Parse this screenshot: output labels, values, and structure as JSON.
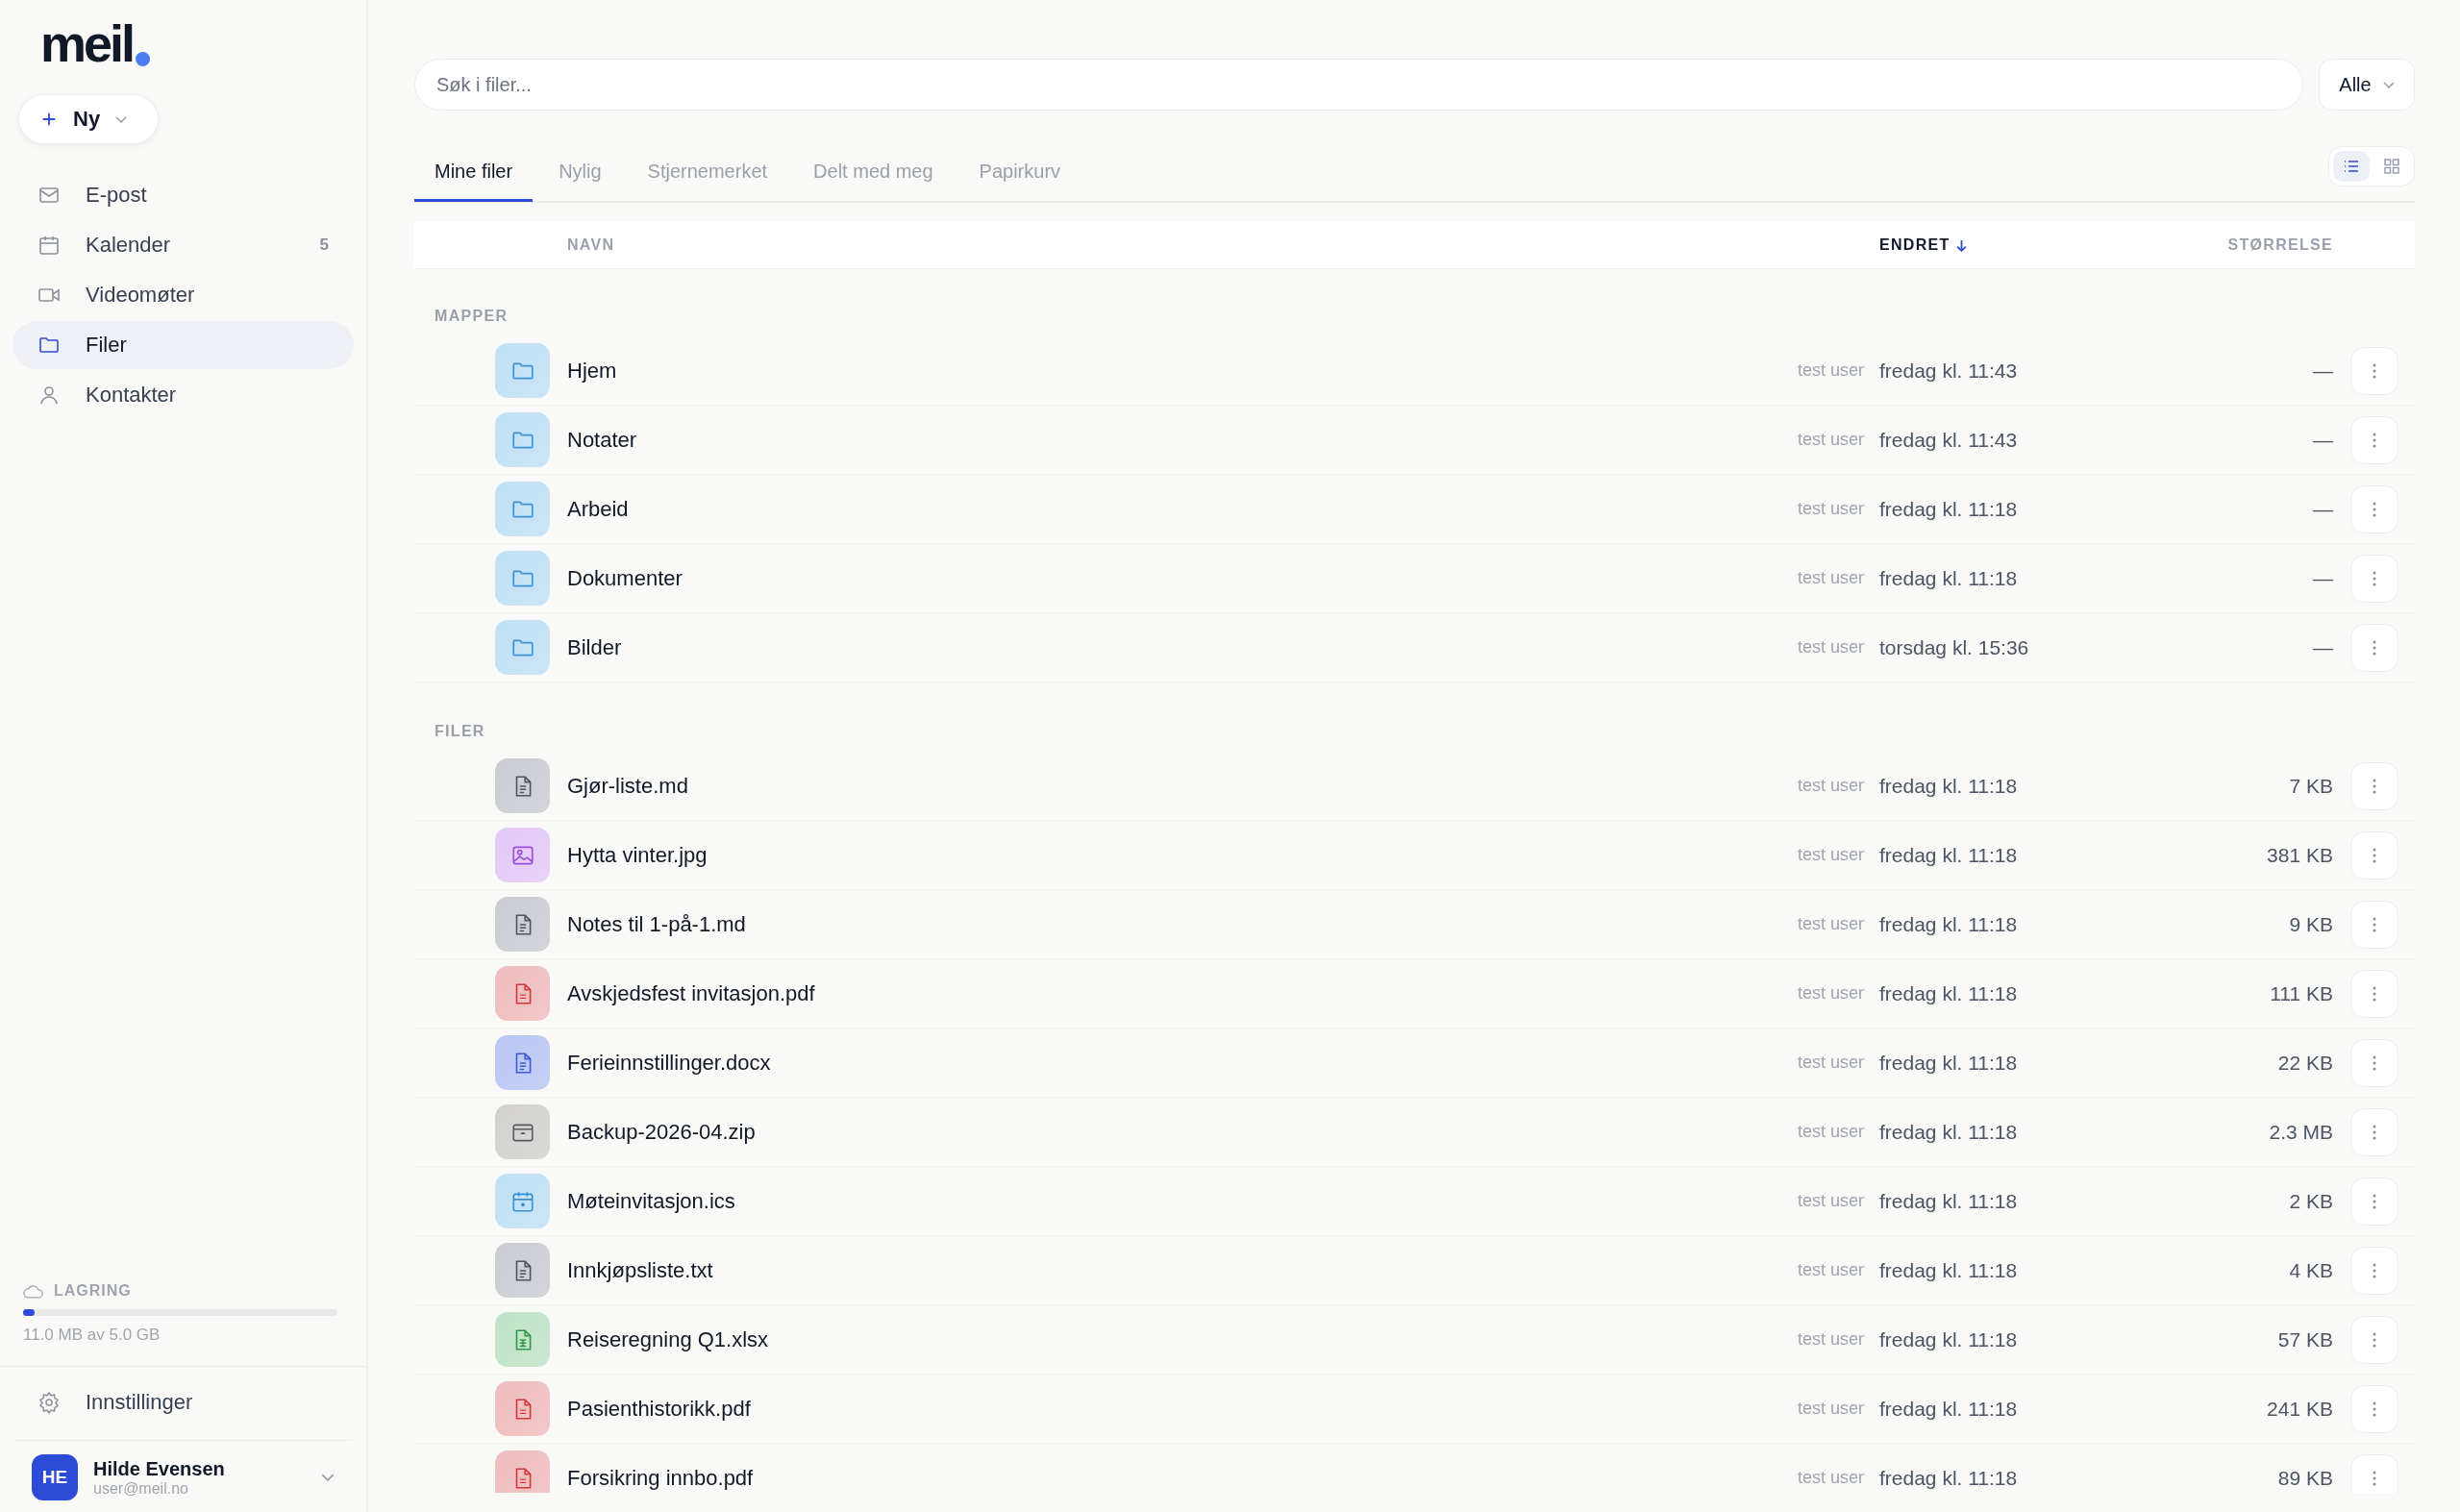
{
  "logo": {
    "text": "meil"
  },
  "new_button": {
    "label": "Ny"
  },
  "nav": [
    {
      "kind": "mail",
      "label": "E-post",
      "selected": false
    },
    {
      "kind": "calendar",
      "label": "Kalender",
      "badge": "5",
      "selected": false
    },
    {
      "kind": "video",
      "label": "Videomøter",
      "selected": false
    },
    {
      "kind": "folder",
      "label": "Filer",
      "selected": true
    },
    {
      "kind": "person",
      "label": "Kontakter",
      "selected": false
    }
  ],
  "storage": {
    "title": "LAGRING",
    "level": 0.0022,
    "usage": "11.0 MB av 5.0 GB"
  },
  "settings": {
    "label": "Innstillinger"
  },
  "user": {
    "initials": "HE",
    "name": "Hilde Evensen",
    "email": "user@meil.no"
  },
  "search": {
    "placeholder": "Søk i filer..."
  },
  "filter": {
    "value": "Alle"
  },
  "tabs": [
    {
      "label": "Mine filer",
      "selected": true
    },
    {
      "label": "Nylig",
      "selected": false
    },
    {
      "label": "Stjernemerket",
      "selected": false
    },
    {
      "label": "Delt med meg",
      "selected": false
    },
    {
      "label": "Papirkurv",
      "selected": false
    }
  ],
  "view_toggle": [
    {
      "kind": "list",
      "selected": true
    },
    {
      "kind": "grid",
      "selected": false
    }
  ],
  "table": {
    "columns": [
      {
        "label": "NAVN",
        "sorted": false
      },
      {
        "label": "ENDRET",
        "sorted": true
      },
      {
        "label": "STØRRELSE",
        "sorted": false
      }
    ],
    "sections": [
      {
        "title": "MAPPER",
        "rows": [
          {
            "kind": "folder",
            "name": "Hjem",
            "owner": "test user",
            "modified": "fredag kl. 11:43",
            "size": "—"
          },
          {
            "kind": "folder",
            "name": "Notater",
            "owner": "test user",
            "modified": "fredag kl. 11:43",
            "size": "—"
          },
          {
            "kind": "folder",
            "name": "Arbeid",
            "owner": "test user",
            "modified": "fredag kl. 11:18",
            "size": "—"
          },
          {
            "kind": "folder",
            "name": "Dokumenter",
            "owner": "test user",
            "modified": "fredag kl. 11:18",
            "size": "—"
          },
          {
            "kind": "folder",
            "name": "Bilder",
            "owner": "test user",
            "modified": "torsdag kl. 15:36",
            "size": "—"
          }
        ]
      },
      {
        "title": "FILER",
        "rows": [
          {
            "kind": "text",
            "name": "Gjør-liste.md",
            "owner": "test user",
            "modified": "fredag kl. 11:18",
            "size": "7 KB"
          },
          {
            "kind": "image",
            "name": "Hytta vinter.jpg",
            "owner": "test user",
            "modified": "fredag kl. 11:18",
            "size": "381 KB"
          },
          {
            "kind": "text",
            "name": "Notes til 1-på-1.md",
            "owner": "test user",
            "modified": "fredag kl. 11:18",
            "size": "9 KB"
          },
          {
            "kind": "pdf",
            "name": "Avskjedsfest invitasjon.pdf",
            "owner": "test user",
            "modified": "fredag kl. 11:18",
            "size": "111 KB"
          },
          {
            "kind": "doc",
            "name": "Ferieinnstillinger.docx",
            "owner": "test user",
            "modified": "fredag kl. 11:18",
            "size": "22 KB"
          },
          {
            "kind": "archive",
            "name": "Backup-2026-04.zip",
            "owner": "test user",
            "modified": "fredag kl. 11:18",
            "size": "2.3 MB"
          },
          {
            "kind": "calendar",
            "name": "Møteinvitasjon.ics",
            "owner": "test user",
            "modified": "fredag kl. 11:18",
            "size": "2 KB"
          },
          {
            "kind": "text",
            "name": "Innkjøpsliste.txt",
            "owner": "test user",
            "modified": "fredag kl. 11:18",
            "size": "4 KB"
          },
          {
            "kind": "sheet",
            "name": "Reiseregning Q1.xlsx",
            "owner": "test user",
            "modified": "fredag kl. 11:18",
            "size": "57 KB"
          },
          {
            "kind": "pdf",
            "name": "Pasienthistorikk.pdf",
            "owner": "test user",
            "modified": "fredag kl. 11:18",
            "size": "241 KB"
          },
          {
            "kind": "pdf",
            "name": "Forsikring innbo.pdf",
            "owner": "test user",
            "modified": "fredag kl. 11:18",
            "size": "89 KB"
          }
        ]
      }
    ]
  }
}
